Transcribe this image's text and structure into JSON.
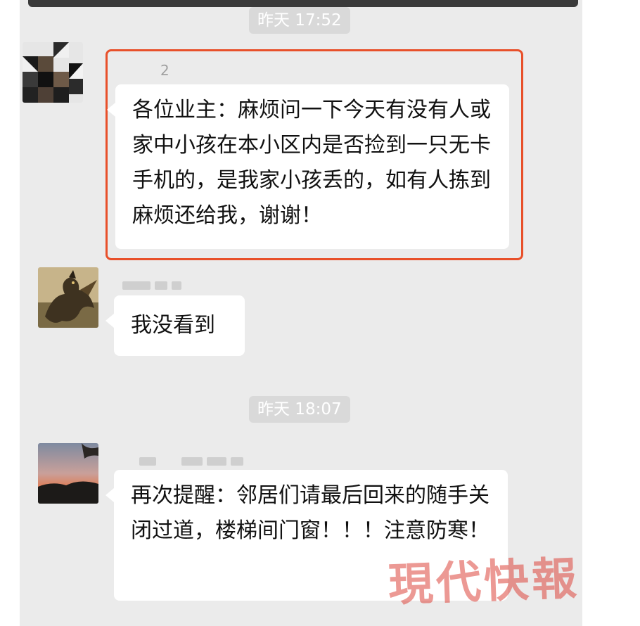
{
  "chat": {
    "timestamp1": "昨天 17:52",
    "timestamp2": "昨天 18:07",
    "messages": [
      {
        "sender": "2",
        "text": "各位业主：麻烦问一下今天有没有人或家中小孩在本小区内是否捡到一只无卡手机的，是我家小孩丢的，如有人拣到麻烦还给我，谢谢！",
        "highlighted": true
      },
      {
        "sender": "",
        "text": "我没看到"
      },
      {
        "sender": "",
        "text": "再次提醒：邻居们请最后回来的随手关闭过道，楼梯间门窗！！！注意防寒！"
      }
    ]
  },
  "watermark": {
    "text": "現代快報"
  },
  "colors": {
    "background": "#ebebeb",
    "bubble": "#ffffff",
    "highlight_border": "#e8502a",
    "timestamp_bg": "#d9d9d9",
    "watermark": "#dc463c"
  }
}
